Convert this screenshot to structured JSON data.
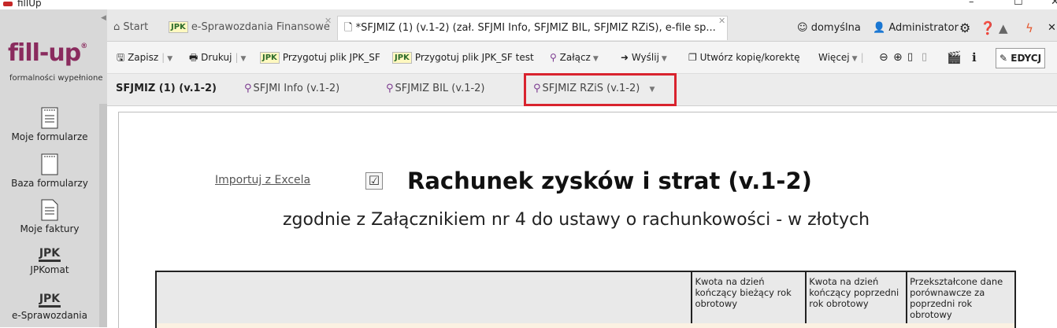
{
  "window": {
    "title": "fillUp",
    "min": "–",
    "max": "☐",
    "close": "✕"
  },
  "sidebar": {
    "logo_text": "fill-up",
    "logo_reg": "®",
    "tagline": "formalności wypełnione",
    "items": [
      {
        "label": "Moje formularze",
        "icon": "form-list-icon"
      },
      {
        "label": "Baza formularzy",
        "icon": "form-base-icon"
      },
      {
        "label": "Moje faktury",
        "icon": "invoice-icon"
      },
      {
        "label": "JPKomat",
        "icon": "jpk-icon",
        "icon_text": "JPK"
      },
      {
        "label": "e-Sprawozdania",
        "icon": "jpk-icon",
        "icon_text": "JPK"
      }
    ]
  },
  "tabs": {
    "start": "Start",
    "esprawozdania": "e-Sprawozdania Finansowe",
    "jpk_badge": "JPK",
    "active": "*SFJMIZ (1) (v.1-2) (zał. SFJMI Info, SFJMIZ BIL, SFJMIZ RZiS), e-file sp...",
    "close_glyph": "✕",
    "profile": "domyślna",
    "user": "Administrator"
  },
  "toolbar": {
    "save": "Zapisz",
    "print": "Drukuj",
    "prepare_jpk": "Przygotuj plik JPK_SF",
    "prepare_jpk_test": "Przygotuj plik JPK_SF test",
    "attach": "Załącz",
    "send": "Wyślij",
    "copy": "Utwórz kopię/korektę",
    "more": "Więcej",
    "edit": "EDYCJ"
  },
  "doc_tabs": {
    "main": "SFJMIZ (1) (v.1-2)",
    "info": "SFJMI Info (v.1-2)",
    "bil": "SFJMIZ BIL (v.1-2)",
    "rzis": "SFJMIZ RZiS (v.1-2)"
  },
  "document": {
    "import_link": "Importuj z Excela",
    "title": "Rachunek zysków i strat (v.1-2)",
    "subtitle": "zgodnie z Załącznikiem nr 4 do ustawy o rachunkowości - w złotych",
    "columns": [
      "Kwota na dzień kończący bieżący rok obrotowy",
      "Kwota na dzień kończący poprzedni rok obrotowy",
      "Przekształcone dane porównawcze za poprzedni rok obrotowy"
    ]
  },
  "colors": {
    "brand": "#8a2b5e",
    "highlight": "#d9232e",
    "clip": "#7b3a8f"
  }
}
